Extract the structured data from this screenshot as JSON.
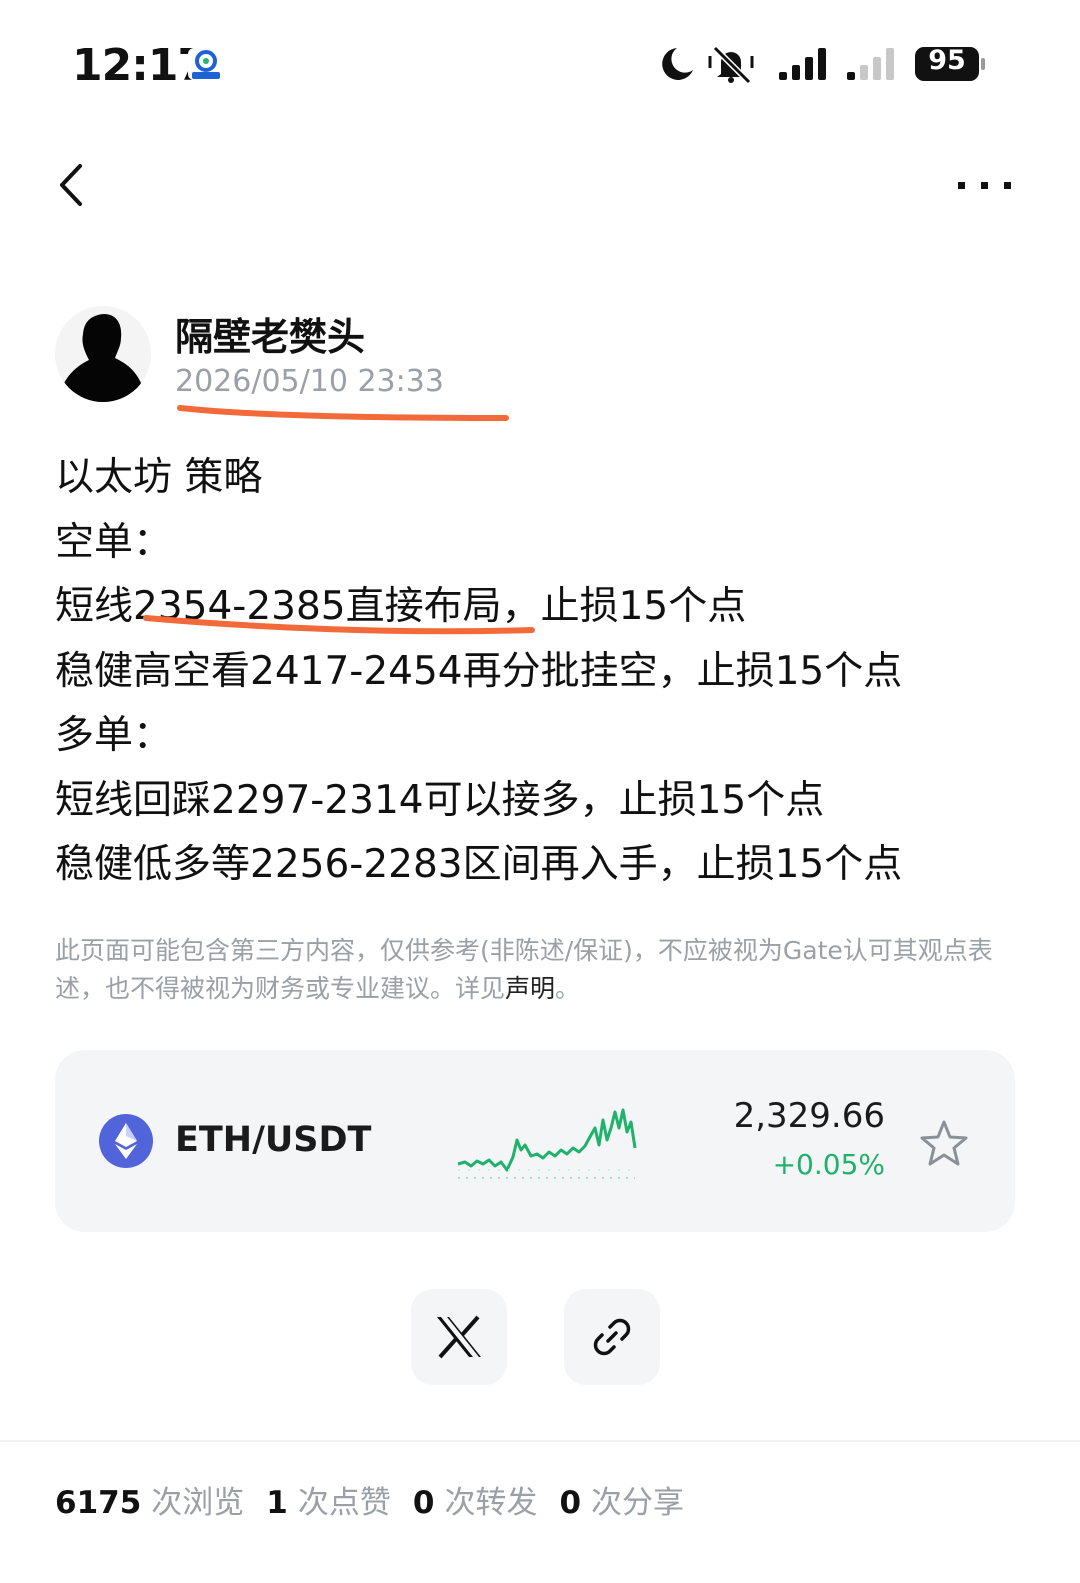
{
  "status_bar": {
    "time": "12:17",
    "battery": "95",
    "icons": [
      "app-badge-icon",
      "moon-icon",
      "bell-muted-icon",
      "signal-icon",
      "signal-weak-icon",
      "battery-icon"
    ]
  },
  "nav": {
    "back_icon": "chevron-left-icon",
    "more_icon": "more-horizontal-icon"
  },
  "post": {
    "author": "隔壁老樊头",
    "timestamp": "2026/05/10 23:33",
    "lines": [
      "以太坊 策略",
      "空单：",
      "短线2354-2385直接布局，止损15个点",
      "稳健高空看2417-2454再分批挂空，止损15个点",
      "多单：",
      "短线回踩2297-2314可以接多，止损15个点",
      "稳健低多等2256-2283区间再入手，止损15个点"
    ],
    "disclaimer": "此页面可能包含第三方内容，仅供参考(非陈述/保证)，不应被视为Gate认可其观点表述，也不得被视为财务或专业建议。详见",
    "disclaimer_link": "声明",
    "disclaimer_end": "。"
  },
  "ticker": {
    "pair": "ETH/USDT",
    "price": "2,329.66",
    "change": "+0.05%",
    "change_color": "#1fb26b",
    "icon": "ethereum-icon"
  },
  "share": {
    "buttons": [
      "x-icon",
      "link-icon"
    ]
  },
  "stats": [
    {
      "value": "6175",
      "label": "次浏览"
    },
    {
      "value": "1",
      "label": "次点赞"
    },
    {
      "value": "0",
      "label": "次转发"
    },
    {
      "value": "0",
      "label": "次分享"
    }
  ],
  "colors": {
    "annotation_underline": "#f26a3a",
    "ethereum": "#5264d9"
  }
}
